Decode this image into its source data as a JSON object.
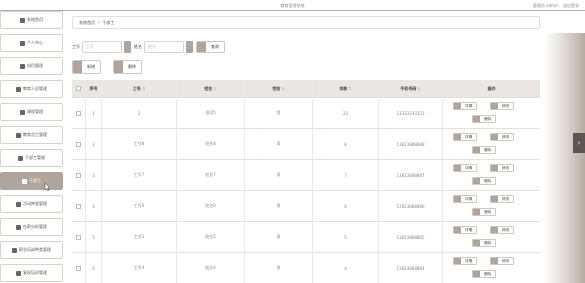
{
  "header": {
    "title": "教育管理系统",
    "user_label": "管理员 admin",
    "logout": "退出登录"
  },
  "sidebar": {
    "items": [
      {
        "label": "系统首页",
        "active": false
      },
      {
        "label": "个人中心",
        "active": false
      },
      {
        "label": "科目管理",
        "active": false
      },
      {
        "label": "教育人员管理",
        "active": false
      },
      {
        "label": "课程管理",
        "active": false
      },
      {
        "label": "教育员工管理",
        "active": false
      },
      {
        "label": "干部工管理",
        "active": false
      },
      {
        "label": "干部工",
        "active": true
      },
      {
        "label": "活动种类管理",
        "active": false
      },
      {
        "label": "在职分析管理",
        "active": false
      },
      {
        "label": "职业培训种类管理",
        "active": false
      },
      {
        "label": "复权培训管理",
        "active": false
      }
    ]
  },
  "breadcrumb": {
    "home": "系统首页",
    "separator": "/",
    "current": "干部工"
  },
  "search": {
    "id_label": "工号",
    "id_placeholder": "工号",
    "name_label": "姓名",
    "name_placeholder": "姓名",
    "query_button": "查询"
  },
  "actions": {
    "add": "新增",
    "delete": "删除"
  },
  "table": {
    "headers": {
      "index": "序号",
      "id": "工号",
      "name": "姓名",
      "sex": "性别",
      "age": "年龄",
      "phone": "手机号码",
      "ops": "操作"
    },
    "op_labels": {
      "detail": "详情",
      "edit": "修改",
      "delete": "删除"
    },
    "rows": [
      {
        "index": "1",
        "id": "3",
        "name": "测试5",
        "sex": "男",
        "age": "22",
        "phone": "13333333333"
      },
      {
        "index": "2",
        "id": "工号8",
        "name": "姓名8",
        "sex": "男",
        "age": "8",
        "phone": "13823888888"
      },
      {
        "index": "3",
        "id": "工号7",
        "name": "姓名7",
        "sex": "男",
        "age": "7",
        "phone": "13823888887"
      },
      {
        "index": "4",
        "id": "工号6",
        "name": "姓名6",
        "sex": "男",
        "age": "6",
        "phone": "13823888886"
      },
      {
        "index": "5",
        "id": "工号5",
        "name": "姓名5",
        "sex": "男",
        "age": "5",
        "phone": "13823888885"
      },
      {
        "index": "6",
        "id": "工号4",
        "name": "姓名4",
        "sex": "男",
        "age": "4",
        "phone": "13823888884"
      }
    ]
  },
  "colors": {
    "accent": "#b0a59c",
    "accent_dark": "#5c5652"
  },
  "icons": {
    "sort": "sort-icon",
    "home": "home-icon",
    "collapse": "chevron-right-icon"
  }
}
